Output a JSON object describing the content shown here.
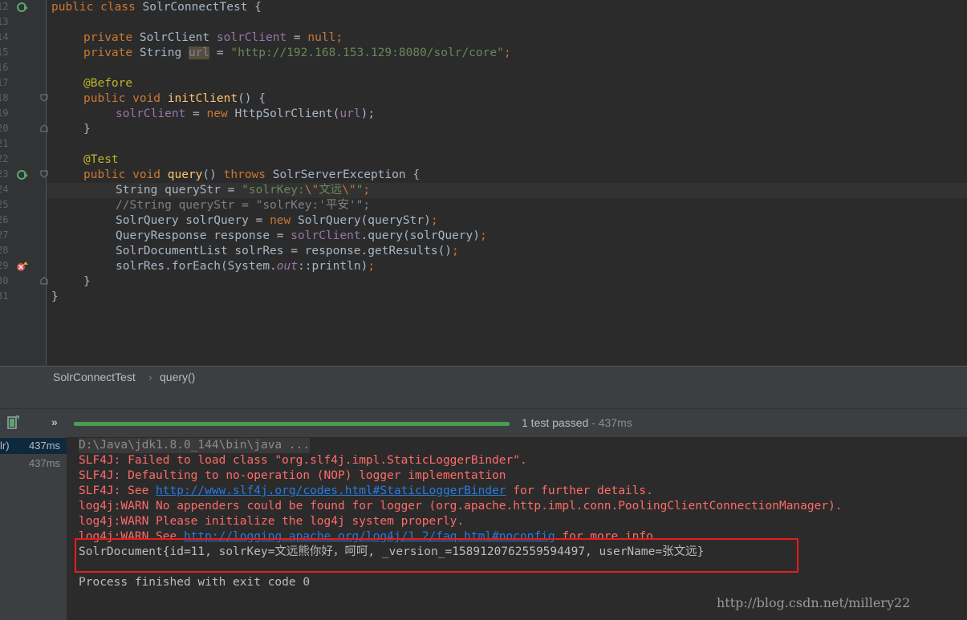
{
  "editor": {
    "line_numbers": [
      "12",
      "13",
      "14",
      "15",
      "16",
      "17",
      "18",
      "19",
      "20",
      "21",
      "22",
      "23",
      "24",
      "25",
      "26",
      "27",
      "28",
      "29",
      "30",
      "31"
    ],
    "code": {
      "l12": {
        "kw": "public class ",
        "name": "SolrConnectTest {"
      },
      "l14": {
        "kw": "private ",
        "type": "SolrClient ",
        "field": "solrClient",
        "eq": " = ",
        "val": "null",
        "semi": ";"
      },
      "l15": {
        "kw": "private ",
        "type": "String ",
        "field": "url",
        "eq": " = ",
        "val": "\"http://192.168.153.129:8080/solr/core\"",
        "semi": ";"
      },
      "l17": {
        "ann": "@Before"
      },
      "l18": {
        "kw": "public void ",
        "mth": "initClient",
        "rest": "() {"
      },
      "l19": {
        "field": "solrClient",
        "eq": " = ",
        "kw": "new ",
        "rest": "HttpSolrClient(",
        "arg": "url",
        "close": ");"
      },
      "l20": {
        "text": "}"
      },
      "l22": {
        "ann": "@Test"
      },
      "l23": {
        "kw": "public void ",
        "mth": "query",
        "mid": "() ",
        "kw2": "throws ",
        "rest": "SolrServerException {"
      },
      "l24": {
        "pre": "String queryStr = ",
        "str": "\"solrKey:",
        "esc": "\\\"",
        "cn": "文远",
        "esc2": "\\\"",
        "end": "\"",
        "semi": ";"
      },
      "l25": {
        "cmt": "//String queryStr = \"solrKey:'平安'\";"
      },
      "l26": {
        "pre": "SolrQuery solrQuery = ",
        "kw": "new ",
        "rest": "SolrQuery(queryStr)",
        "semi": ";"
      },
      "l27": {
        "pre": "QueryResponse response = ",
        "field": "solrClient",
        "rest": ".query(solrQuery)",
        "semi": ";"
      },
      "l28": {
        "pre": "SolrDocumentList solrRes = response.getResults()",
        "semi": ";"
      },
      "l29": {
        "pre": "solrRes.forEach(System.",
        "stat": "out",
        "rest": "::println)",
        "semi": ";"
      },
      "l30": {
        "text": "}"
      },
      "l31": {
        "text": "}"
      }
    }
  },
  "breadcrumb": {
    "items": [
      "SolrConnectTest",
      "query()"
    ],
    "separator": "›"
  },
  "runbar": {
    "expand_label": "»",
    "progress_fraction": 1.0,
    "status_main": "1 test passed",
    "status_time": "- 437ms",
    "accent": "#499c54"
  },
  "tree": {
    "rows": [
      {
        "label": "lr)",
        "time": "437ms"
      },
      {
        "label": "",
        "time": "437ms"
      }
    ]
  },
  "console": {
    "cmd": "D:\\Java\\jdk1.8.0_144\\bin\\java ...",
    "lines": [
      {
        "a": "SLF4J: Failed to load class \"org.slf4j.impl.StaticLoggerBinder\"."
      },
      {
        "a": "SLF4J: Defaulting to no-operation (NOP) logger implementation"
      },
      {
        "a": "SLF4J: See ",
        "link": "http://www.slf4j.org/codes.html#StaticLoggerBinder",
        "b": " for further details."
      },
      {
        "a": "log4j:WARN No appenders could be found for logger (org.apache.http.impl.conn.PoolingClientConnectionManager)."
      },
      {
        "a": "log4j:WARN Please initialize the log4j system properly."
      },
      {
        "a": "log4j:WARN See ",
        "link": "http://logging.apache.org/log4j/1.2/faq.html#noconfig",
        "b": " for more info."
      }
    ],
    "result": "SolrDocument{id=11, solrKey=文远熊你好，呵呵, _version_=1589120762559594497, userName=张文远}",
    "exit": "Process finished with exit code 0"
  },
  "watermark": "http://blog.csdn.net/millery22",
  "colors": {
    "error": "#ff6b68",
    "link": "#287bde",
    "highlight_box": "#e81c1c"
  }
}
